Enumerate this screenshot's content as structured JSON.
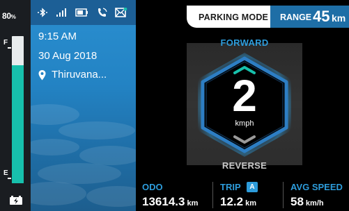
{
  "battery": {
    "percent": "80",
    "unit": "%",
    "level": 0.8,
    "full_label": "F",
    "empty_label": "E",
    "fill_color": "#17c0ac"
  },
  "status_bar": {
    "icons": [
      "bluetooth-icon",
      "signal-bars-icon",
      "phone-battery-icon",
      "phone-call-icon",
      "message-icon"
    ]
  },
  "info": {
    "time": "9:15 AM",
    "date": "30 Aug 2018",
    "location": "Thiruvana..."
  },
  "header": {
    "mode_label": "PARKING MODE",
    "range_label": "RANGE",
    "range_value": "45",
    "range_unit": "km"
  },
  "gear": {
    "forward_label": "FORWARD",
    "reverse_label": "REVERSE",
    "speed": "2",
    "speed_unit": "kmph",
    "accent": "#2d9cdb"
  },
  "stats": {
    "odo": {
      "label": "ODO",
      "value": "13614.3",
      "unit": "km"
    },
    "trip": {
      "label": "TRIP",
      "badge": "A",
      "value": "12.2",
      "unit": "km"
    },
    "avg_speed": {
      "label": "AVG SPEED",
      "value": "58",
      "unit": "km/h"
    }
  }
}
